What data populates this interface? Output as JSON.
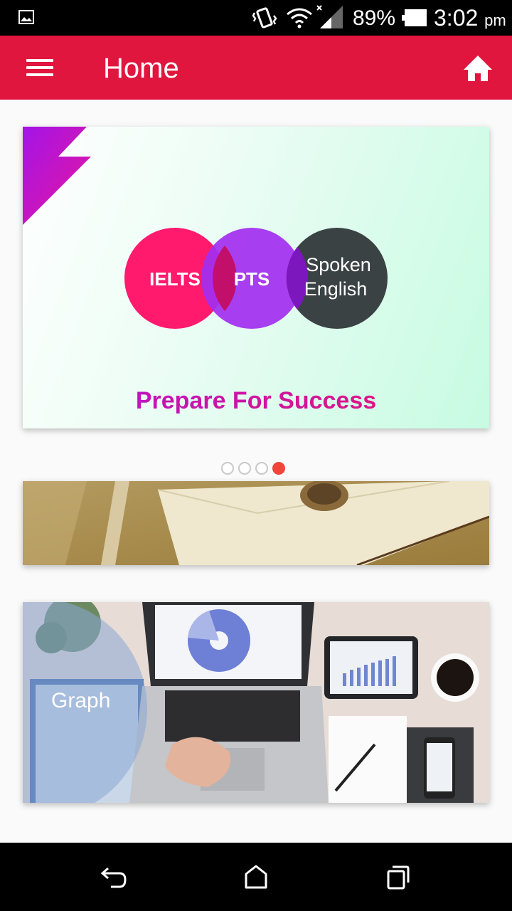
{
  "status_bar": {
    "battery_percent": "89%",
    "time": "3:02",
    "ampm": "pm",
    "icons": [
      "gallery-icon",
      "vibrate-icon",
      "wifi-icon",
      "signal-icon",
      "battery-icon"
    ]
  },
  "app_bar": {
    "title": "Home",
    "color": "#e0163e",
    "menu_icon": "hamburger-menu-icon",
    "home_icon": "home-icon"
  },
  "carousel": {
    "banner": {
      "circle_1": "IELTS",
      "circle_2": "PTS",
      "circle_3_line_1": "Spoken",
      "circle_3_line_2": "English",
      "tagline": "Prepare For Success"
    },
    "page_count": 4,
    "active_page": 4,
    "active_color": "#f0453b"
  },
  "cards": [
    {
      "label": "",
      "image": "envelope-with-wax-seal"
    },
    {
      "label": "Graph",
      "image": "desk-with-laptop-charts"
    }
  ],
  "nav_bar": {
    "icons": [
      "back-icon",
      "home-nav-icon",
      "recents-icon"
    ]
  }
}
